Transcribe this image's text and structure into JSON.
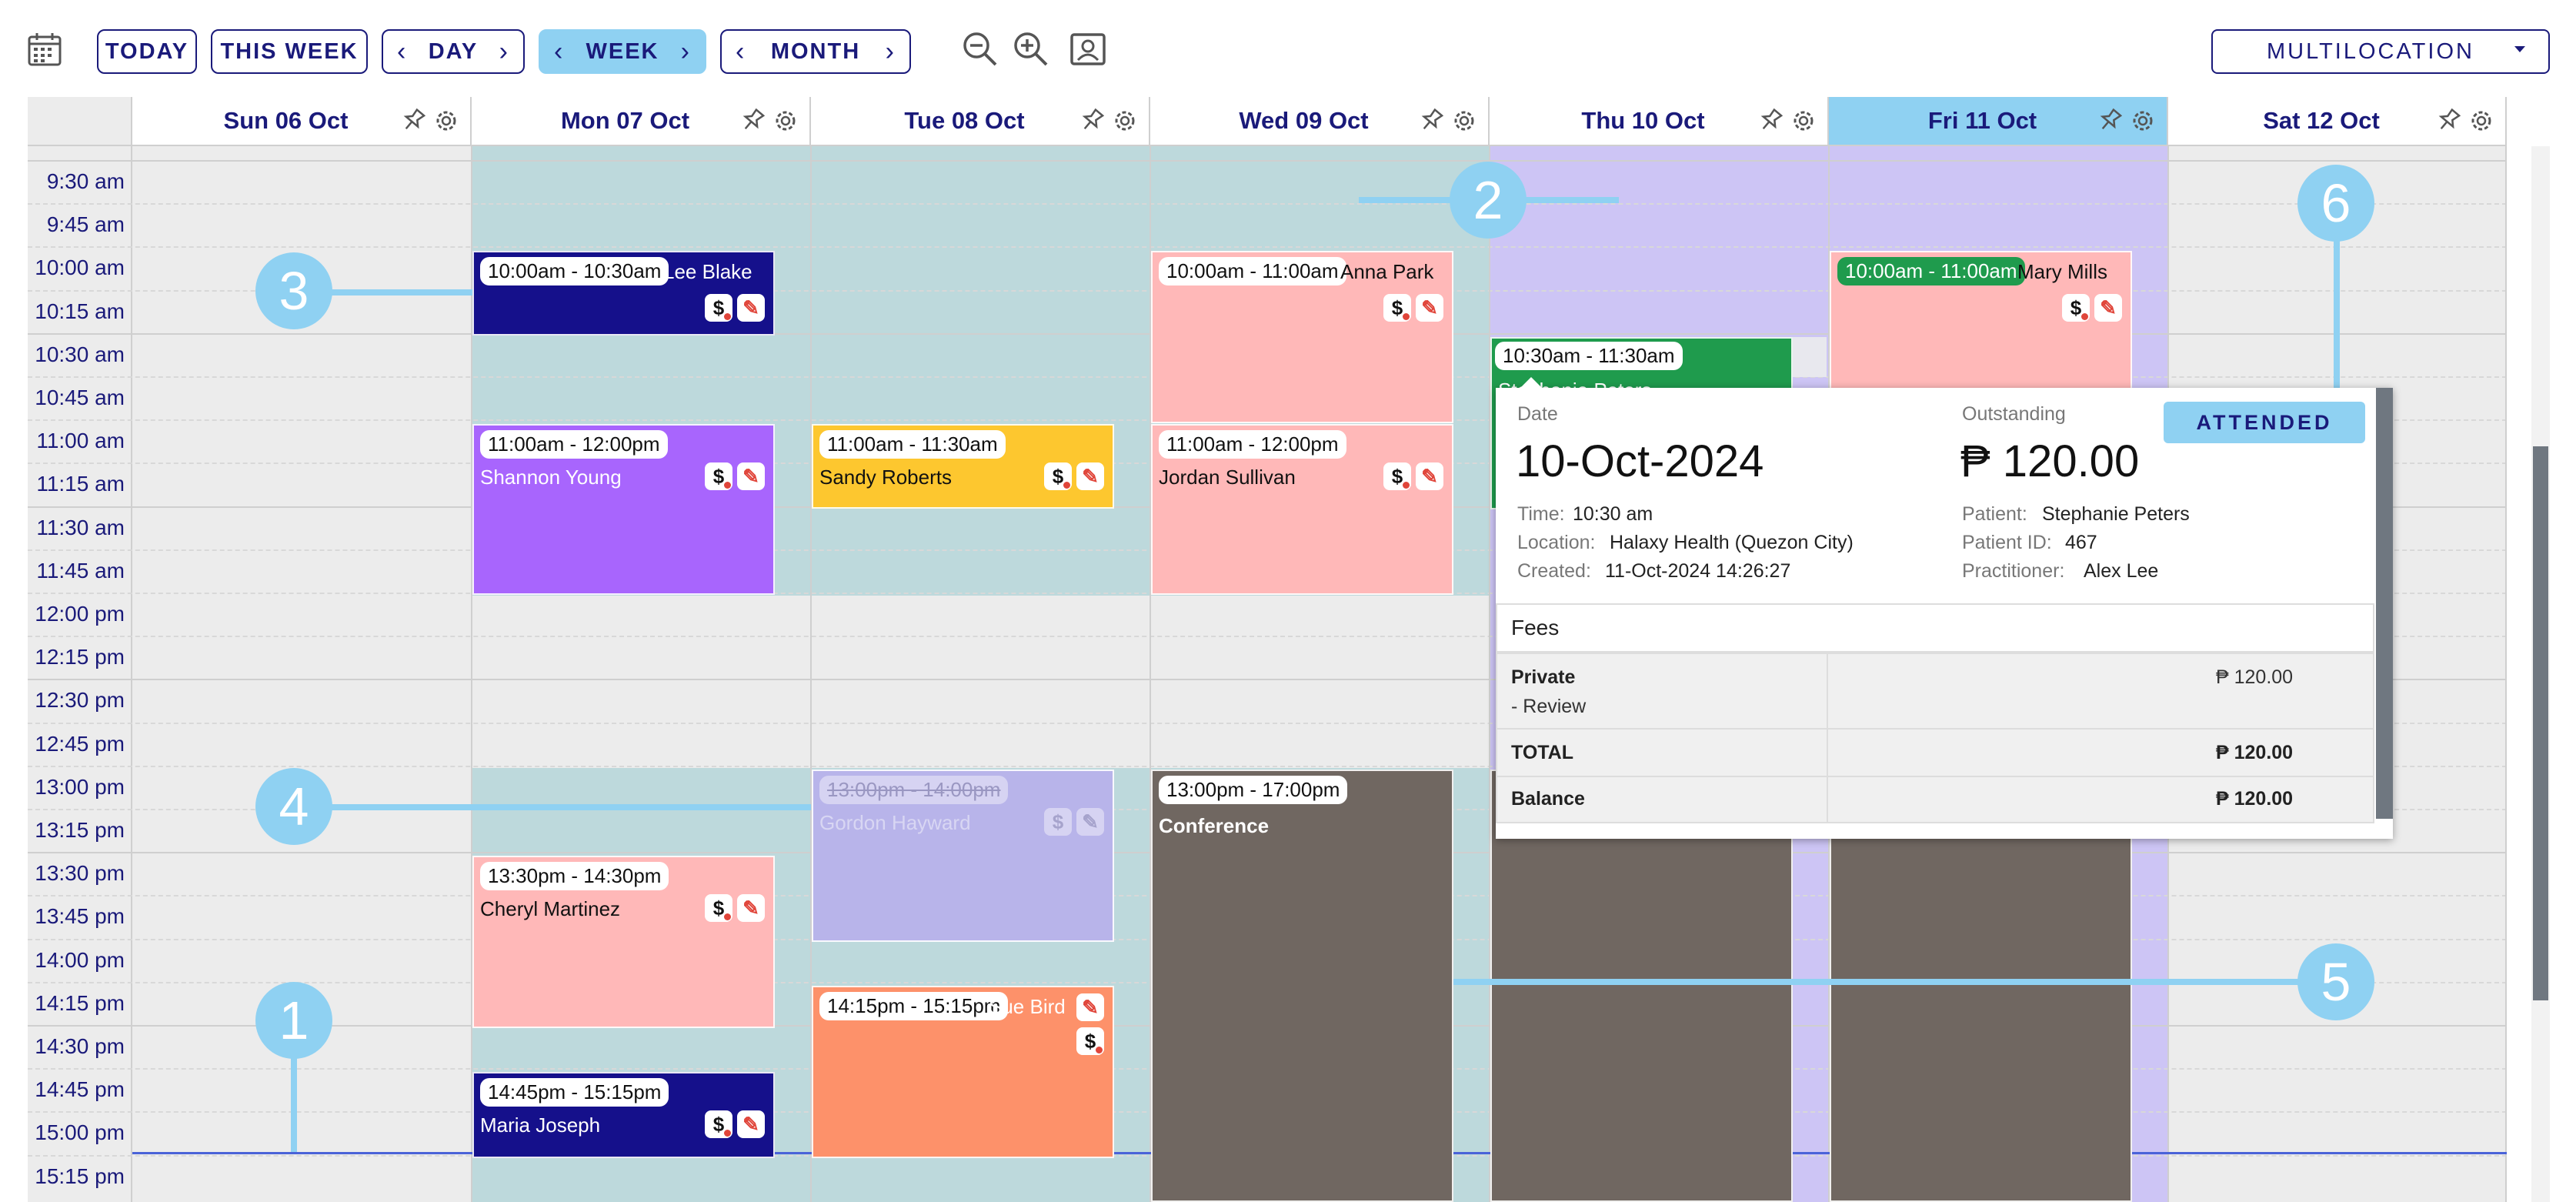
{
  "toolbar": {
    "today": "TODAY",
    "this_week": "THIS WEEK",
    "day": "DAY",
    "week": "WEEK",
    "month": "MONTH",
    "location": "MULTILOCATION"
  },
  "days": [
    "Sun 06 Oct",
    "Mon 07 Oct",
    "Tue 08 Oct",
    "Wed 09 Oct",
    "Thu 10 Oct",
    "Fri 11 Oct",
    "Sat 12 Oct"
  ],
  "times": [
    "9:30 am",
    "9:45 am",
    "10:00 am",
    "10:15 am",
    "10:30 am",
    "10:45 am",
    "11:00 am",
    "11:15 am",
    "11:30 am",
    "11:45 am",
    "12:00 pm",
    "12:15 pm",
    "12:30 pm",
    "12:45 pm",
    "13:00 pm",
    "13:15 pm",
    "13:30 pm",
    "13:45 pm",
    "14:00 pm",
    "14:15 pm",
    "14:30 pm",
    "14:45 pm",
    "15:00 pm",
    "15:15 pm"
  ],
  "events": {
    "lee": {
      "time": "10:00am - 10:30am",
      "name": "Lee Blake"
    },
    "anna": {
      "time": "10:00am - 11:00am",
      "name": "Anna Park"
    },
    "mary": {
      "time": "10:00am - 11:00am",
      "name": "Mary Mills"
    },
    "steph": {
      "time": "10:30am - 11:30am",
      "name": "Stephanie Peters"
    },
    "shannon": {
      "time": "11:00am - 12:00pm",
      "name": "Shannon Young"
    },
    "sandy": {
      "time": "11:00am - 11:30am",
      "name": "Sandy Roberts"
    },
    "jordan": {
      "time": "11:00am - 12:00pm",
      "name": "Jordan Sullivan"
    },
    "gordon": {
      "time": "13:00pm - 14:00pm",
      "name": "Gordon Hayward"
    },
    "conf": {
      "time": "13:00pm - 17:00pm",
      "name": "Conference"
    },
    "cheryl": {
      "time": "13:30pm - 14:30pm",
      "name": "Cheryl Martinez"
    },
    "sue": {
      "time": "14:15pm - 15:15pm",
      "name": "Sue Bird"
    },
    "maria": {
      "time": "14:45pm - 15:15pm",
      "name": "Maria Joseph"
    }
  },
  "callouts": [
    "1",
    "2",
    "3",
    "4",
    "5",
    "6"
  ],
  "popup": {
    "date_label": "Date",
    "date": "10-Oct-2024",
    "outstanding_label": "Outstanding",
    "outstanding": "₱ 120.00",
    "status": "ATTENDED",
    "time_label": "Time:",
    "time": "10:30 am",
    "location_label": "Location:",
    "location": "Halaxy Health (Quezon City)",
    "created_label": "Created:",
    "created": "11-Oct-2024 14:26:27",
    "patient_label": "Patient:",
    "patient": "Stephanie Peters",
    "patient_id_label": "Patient ID:",
    "patient_id": "467",
    "practitioner_label": "Practitioner:",
    "practitioner": "Alex Lee",
    "fees_title": "Fees",
    "fee_name": "Private",
    "fee_sub": "- Review",
    "fee_amount": "₱ 120.00",
    "total_label": "TOTAL",
    "total": "₱ 120.00",
    "balance_label": "Balance",
    "balance": "₱ 120.00"
  },
  "colors": {
    "navy": "#1a1a7a",
    "accent": "#8fd1f2",
    "teal_bg": "#bdd9dc",
    "lavender_bg": "#cdc5f5",
    "closed_bg": "#ececec",
    "pink": "#ffb8b8",
    "purple": "#a865fd",
    "yellow": "#fdc72f",
    "orange": "#fd916a",
    "green": "#1f9b4d",
    "brown": "#706761",
    "cancelled": "#b8b4ea"
  }
}
